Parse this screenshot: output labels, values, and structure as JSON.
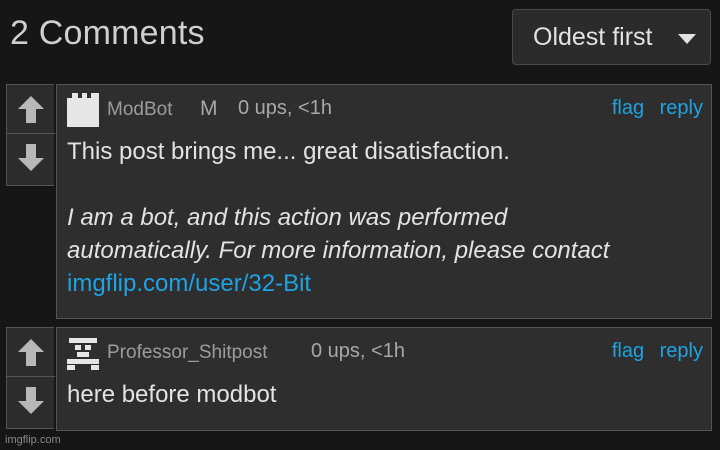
{
  "header": {
    "comment_count_label": "2 Comments",
    "sort_label": "Oldest first"
  },
  "comments": [
    {
      "username": "ModBot",
      "mod_badge": "M",
      "meta": "0 ups, <1h",
      "flag_label": "flag",
      "reply_label": "reply",
      "line1": "This post brings me... great disatisfaction.",
      "italic_line_a": "I am a bot, and this action was performed",
      "italic_line_b_1": "automatically",
      "italic_line_b_2": ". For more information, please contact",
      "link": "imgflip.com/user/32-Bit"
    },
    {
      "username": "Professor_Shitpost",
      "meta": "0 ups, <1h",
      "flag_label": "flag",
      "reply_label": "reply",
      "line1": "here before modbot"
    }
  ],
  "watermark": "imgflip.com",
  "icons": {
    "upvote": "arrow-up-icon",
    "downvote": "arrow-down-icon",
    "sort_caret": "caret-down-icon"
  },
  "colors": {
    "background": "#161616",
    "panel": "#2e2e2e",
    "link": "#1fa3e3",
    "text": "#e3e3e3"
  }
}
